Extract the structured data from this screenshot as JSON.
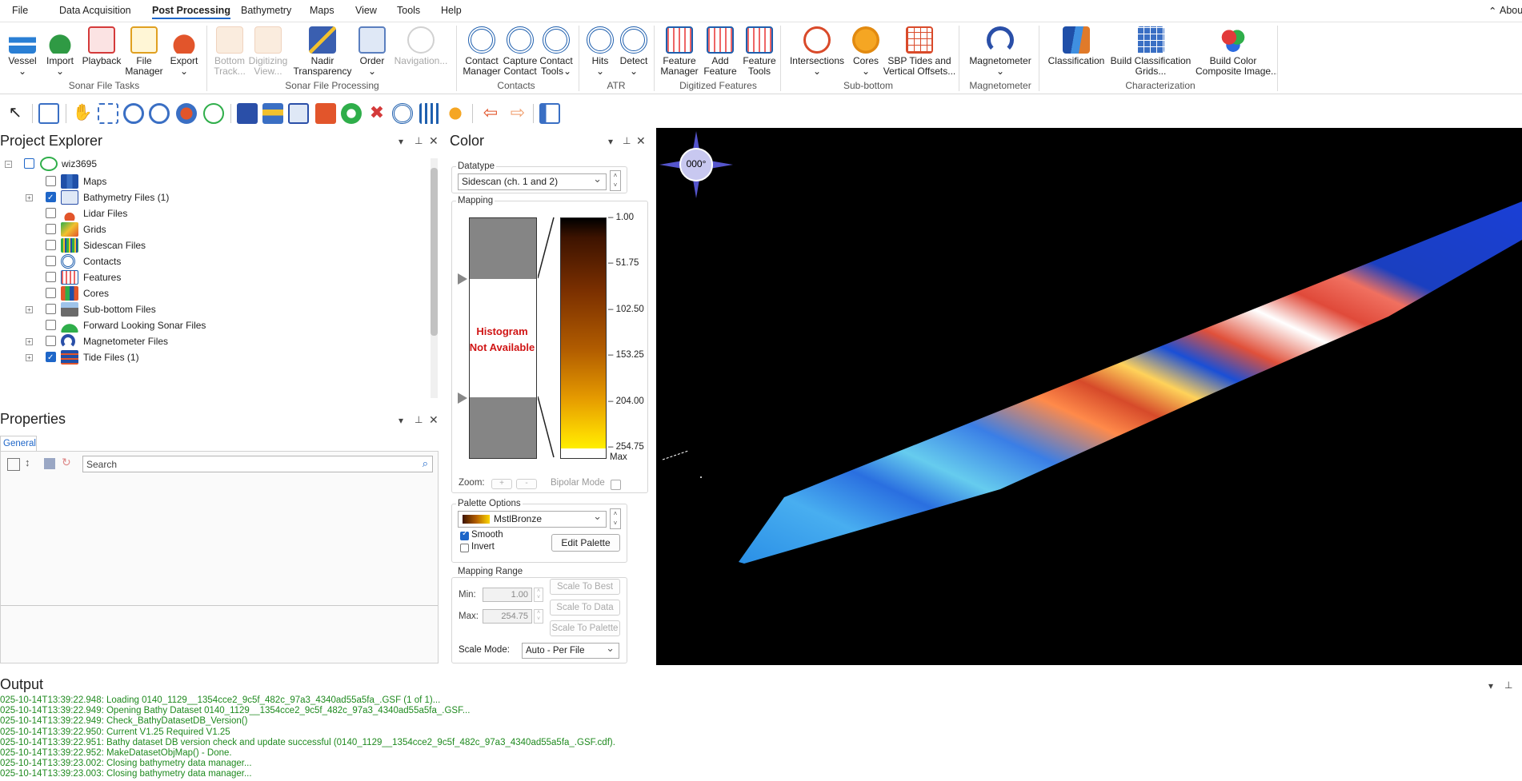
{
  "menu": {
    "items": [
      "File",
      "Data Acquisition",
      "Post Processing",
      "Bathymetry",
      "Maps",
      "View",
      "Tools",
      "Help"
    ],
    "active": "Post Processing",
    "about": "Abou"
  },
  "ribbon": {
    "sonar_file_tasks": {
      "label": "Sonar File Tasks",
      "buttons": [
        "Vessel",
        "Import",
        "Playback",
        "File\nManager",
        "Export"
      ]
    },
    "sonar_file_processing": {
      "label": "Sonar File Processing",
      "buttons": [
        "Bottom\nTrack...",
        "Digitizing\nView...",
        "Nadir\nTransparency",
        "Order",
        "Navigation..."
      ]
    },
    "contacts": {
      "label": "Contacts",
      "buttons": [
        "Contact\nManager",
        "Capture\nContact",
        "Contact\nTools"
      ]
    },
    "atr": {
      "label": "ATR",
      "buttons": [
        "Hits",
        "Detect"
      ]
    },
    "digitized_features": {
      "label": "Digitized Features",
      "buttons": [
        "Feature\nManager",
        "Add\nFeature",
        "Feature\nTools"
      ]
    },
    "sub_bottom": {
      "label": "Sub-bottom",
      "buttons": [
        "Intersections",
        "Cores",
        "SBP Tides and\nVertical Offsets..."
      ]
    },
    "magnetometer": {
      "label": "Magnetometer",
      "buttons": [
        "Magnetometer"
      ]
    },
    "characterization": {
      "label": "Characterization",
      "buttons": [
        "Classification",
        "Build Classification\nGrids...",
        "Build Color\nComposite Image..."
      ]
    }
  },
  "project_explorer": {
    "title": "Project Explorer",
    "root": "wiz3695",
    "items": [
      {
        "label": "Maps",
        "checked": false,
        "expandable": false,
        "icon": "map-icon"
      },
      {
        "label": "Bathymetry Files (1)",
        "checked": true,
        "expandable": true,
        "icon": "bathymetry-icon"
      },
      {
        "label": "Lidar Files",
        "checked": false,
        "expandable": false,
        "icon": "lidar-icon"
      },
      {
        "label": "Grids",
        "checked": false,
        "expandable": false,
        "icon": "grid-icon"
      },
      {
        "label": "Sidescan Files",
        "checked": false,
        "expandable": false,
        "icon": "sidescan-icon"
      },
      {
        "label": "Contacts",
        "checked": false,
        "expandable": false,
        "icon": "contact-icon"
      },
      {
        "label": "Features",
        "checked": false,
        "expandable": false,
        "icon": "feature-icon"
      },
      {
        "label": "Cores",
        "checked": false,
        "expandable": false,
        "icon": "core-icon"
      },
      {
        "label": "Sub-bottom Files",
        "checked": false,
        "expandable": true,
        "icon": "subbottom-icon"
      },
      {
        "label": "Forward Looking Sonar Files",
        "checked": false,
        "expandable": false,
        "icon": "fls-icon"
      },
      {
        "label": "Magnetometer Files",
        "checked": false,
        "expandable": true,
        "icon": "magnet-icon"
      },
      {
        "label": "Tide Files (1)",
        "checked": true,
        "expandable": true,
        "icon": "tide-icon"
      }
    ]
  },
  "properties": {
    "title": "Properties",
    "tab": "General",
    "search_placeholder": "Search"
  },
  "color": {
    "title": "Color",
    "datatype_legend": "Datatype",
    "datatype_value": "Sidescan (ch. 1 and 2)",
    "mapping_legend": "Mapping",
    "histogram_text": "Histogram\nNot Available",
    "scale_ticks": [
      "1.00",
      "51.75",
      "102.50",
      "153.25",
      "204.00",
      "254.75"
    ],
    "scale_max": "Max",
    "zoom_label": "Zoom:",
    "zoom_plus": "+",
    "zoom_minus": "-",
    "bipolar_label": "Bipolar Mode",
    "palette_legend": "Palette Options",
    "palette_name": "MstlBronze",
    "smooth_label": "Smooth",
    "smooth_checked": true,
    "invert_label": "Invert",
    "invert_checked": false,
    "edit_palette": "Edit Palette",
    "range_legend": "Mapping Range",
    "min_label": "Min:",
    "min_value": "1.00",
    "max_label": "Max:",
    "max_value": "254.75",
    "scale_to_best": "Scale To Best",
    "scale_to_data": "Scale To Data",
    "scale_to_palette": "Scale To Palette",
    "scale_mode_label": "Scale Mode:",
    "scale_mode_value": "Auto - Per File"
  },
  "viewport": {
    "compass_heading": "000°"
  },
  "output": {
    "title": "Output",
    "lines": [
      "025-10-14T13:39:22.948: Loading 0140_1129__1354cce2_9c5f_482c_97a3_4340ad55a5fa_.GSF (1 of 1)...",
      "025-10-14T13:39:22.949: Opening Bathy Dataset 0140_1129__1354cce2_9c5f_482c_97a3_4340ad55a5fa_.GSF...",
      "025-10-14T13:39:22.949: Check_BathyDatasetDB_Version()",
      "025-10-14T13:39:22.950:    Current  V1.25    Required  V1.25",
      "025-10-14T13:39:22.951: Bathy dataset DB version check and update successful (0140_1129__1354cce2_9c5f_482c_97a3_4340ad55a5fa_.GSF.cdf).",
      "025-10-14T13:39:22.952: MakeDatasetObjMap() - Done.",
      "025-10-14T13:39:23.002: Closing bathymetry data manager...",
      "025-10-14T13:39:23.003: Closing bathymetry data manager..."
    ]
  }
}
